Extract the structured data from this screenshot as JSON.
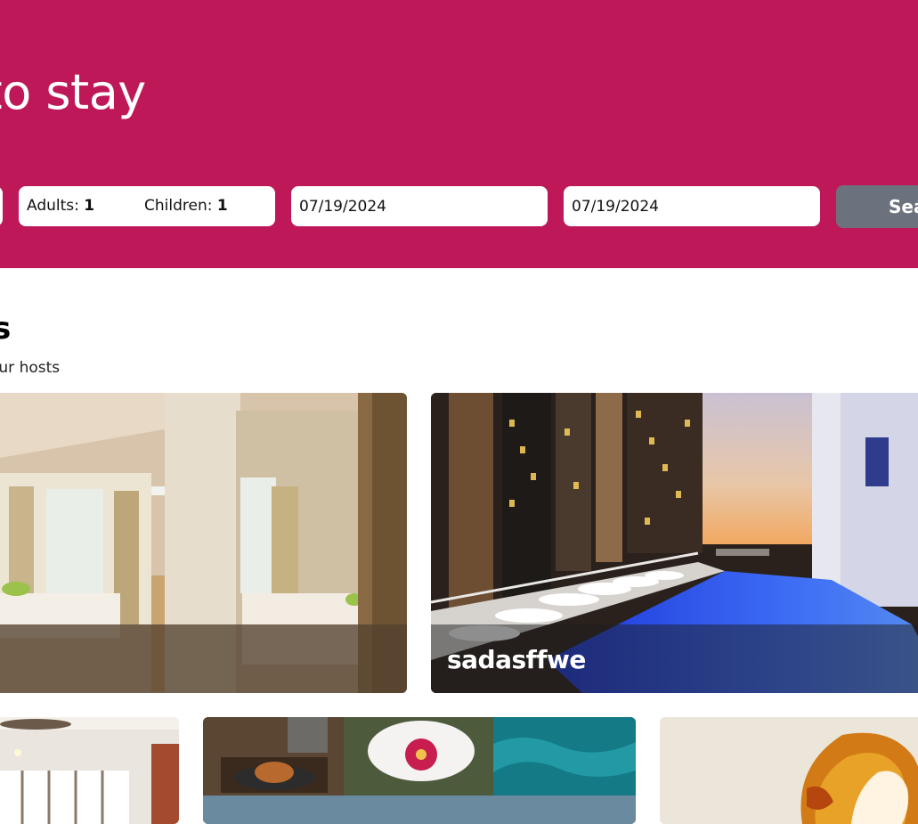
{
  "hero": {
    "title": "els to stay",
    "search": {
      "adults_label": "Adults:",
      "adults_value": "1",
      "children_label": "Children:",
      "children_value": "1",
      "checkin_date": "07/19/2024",
      "checkout_date": "07/19/2024",
      "search_button_label": "Sea"
    }
  },
  "section": {
    "title": "s",
    "subtitle": "our hosts"
  },
  "cards": [
    {
      "label": ""
    },
    {
      "label": "sadasffwe"
    }
  ],
  "colors": {
    "hero_bg": "#be1858",
    "search_button_bg": "#6c727d"
  }
}
